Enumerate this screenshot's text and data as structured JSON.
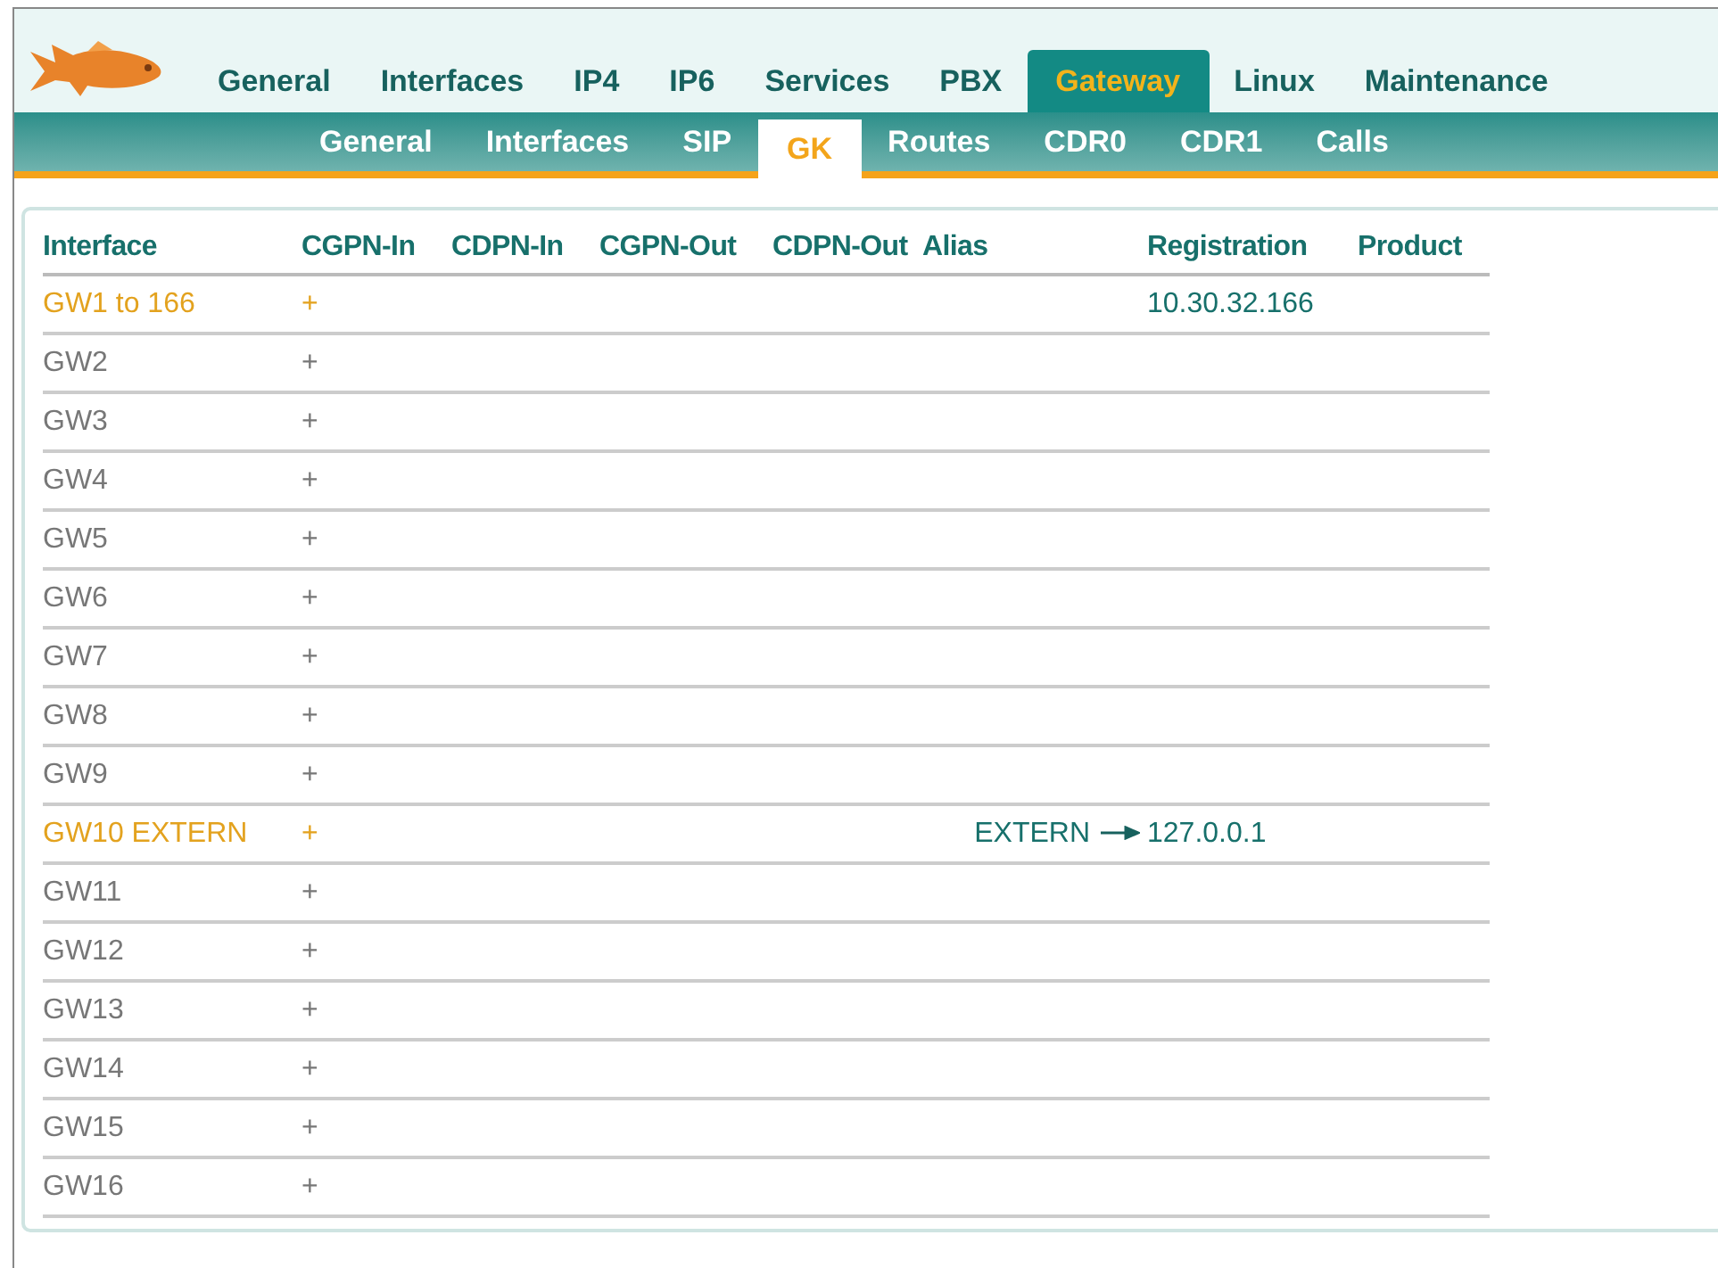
{
  "main_tabs": [
    {
      "label": "General",
      "selected": false
    },
    {
      "label": "Interfaces",
      "selected": false
    },
    {
      "label": "IP4",
      "selected": false
    },
    {
      "label": "IP6",
      "selected": false
    },
    {
      "label": "Services",
      "selected": false
    },
    {
      "label": "PBX",
      "selected": false
    },
    {
      "label": "Gateway",
      "selected": true
    },
    {
      "label": "Linux",
      "selected": false
    },
    {
      "label": "Maintenance",
      "selected": false
    }
  ],
  "sub_tabs": [
    {
      "label": "General",
      "selected": false
    },
    {
      "label": "Interfaces",
      "selected": false
    },
    {
      "label": "SIP",
      "selected": false
    },
    {
      "label": "GK",
      "selected": true
    },
    {
      "label": "Routes",
      "selected": false
    },
    {
      "label": "CDR0",
      "selected": false
    },
    {
      "label": "CDR1",
      "selected": false
    },
    {
      "label": "Calls",
      "selected": false
    }
  ],
  "table": {
    "columns": [
      "Interface",
      "CGPN-In",
      "CDPN-In",
      "CGPN-Out",
      "CDPN-Out",
      "Alias",
      "Registration",
      "Product"
    ],
    "rows": [
      {
        "interface": "GW1 to 166",
        "add": "+",
        "active": true,
        "registration": "10.30.32.166"
      },
      {
        "interface": "GW2",
        "add": "+",
        "active": false
      },
      {
        "interface": "GW3",
        "add": "+",
        "active": false
      },
      {
        "interface": "GW4",
        "add": "+",
        "active": false
      },
      {
        "interface": "GW5",
        "add": "+",
        "active": false
      },
      {
        "interface": "GW6",
        "add": "+",
        "active": false
      },
      {
        "interface": "GW7",
        "add": "+",
        "active": false
      },
      {
        "interface": "GW8",
        "add": "+",
        "active": false
      },
      {
        "interface": "GW9",
        "add": "+",
        "active": false
      },
      {
        "interface": "GW10 EXTERN",
        "add": "+",
        "active": true,
        "alias": "EXTERN",
        "registration": "127.0.0.1"
      },
      {
        "interface": "GW11",
        "add": "+",
        "active": false
      },
      {
        "interface": "GW12",
        "add": "+",
        "active": false
      },
      {
        "interface": "GW13",
        "add": "+",
        "active": false
      },
      {
        "interface": "GW14",
        "add": "+",
        "active": false
      },
      {
        "interface": "GW15",
        "add": "+",
        "active": false
      },
      {
        "interface": "GW16",
        "add": "+",
        "active": false
      }
    ]
  }
}
